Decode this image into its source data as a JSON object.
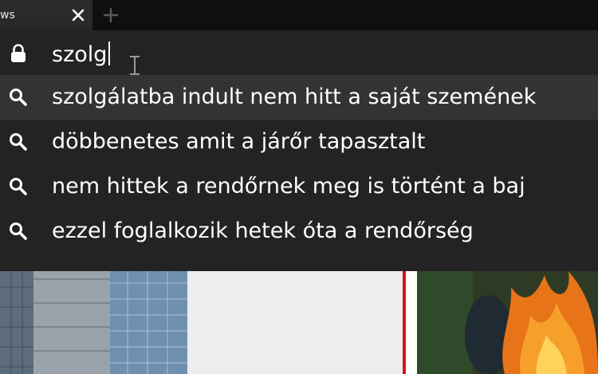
{
  "tab": {
    "title": "ws",
    "close_icon": "close-icon",
    "new_tab_icon": "plus-icon"
  },
  "omnibox": {
    "lock_icon": "lock-icon",
    "query": "szolg",
    "suggestions": [
      {
        "text": "szolgálatba indult nem hitt a saját szemének",
        "icon": "search-icon",
        "selected": true
      },
      {
        "text": "döbbenetes amit a járőr tapasztalt",
        "icon": "search-icon",
        "selected": false
      },
      {
        "text": "nem hittek a rendőrnek meg is történt a baj",
        "icon": "search-icon",
        "selected": false
      },
      {
        "text": "ezzel foglalkozik hetek óta a rendőrség",
        "icon": "search-icon",
        "selected": false
      }
    ]
  },
  "colors": {
    "dropdown_bg": "#232323",
    "selected_row": "#333333",
    "tabstrip_bg": "#0f0f0f",
    "text": "#ffffff",
    "accent_red": "#d01818"
  }
}
